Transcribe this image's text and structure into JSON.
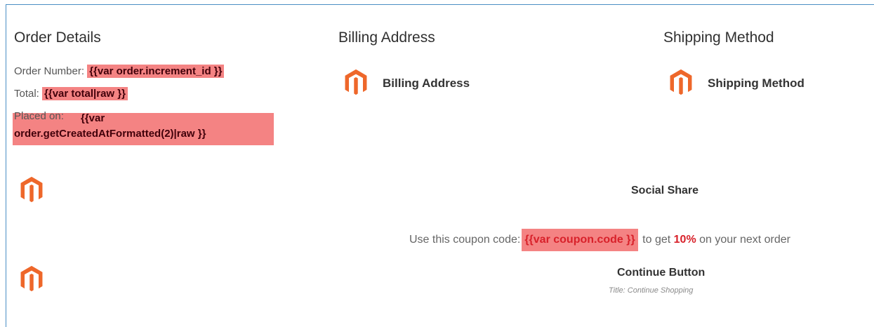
{
  "order_details": {
    "title": "Order Details",
    "order_number_label": "Order Number:",
    "order_number_var": "{{var order.increment_id }}",
    "total_label": "Total:",
    "total_var": "{{var total|raw }}",
    "placed_on_label": "Placed on:",
    "placed_on_var_line1": "{{var",
    "placed_on_var_line2": "order.getCreatedAtFormatted(2)|raw }}"
  },
  "billing": {
    "title": "Billing Address",
    "block_label": "Billing Address"
  },
  "shipping": {
    "title": "Shipping Method",
    "block_label": "Shipping Method"
  },
  "social_share": {
    "label": "Social Share"
  },
  "coupon": {
    "prefix": "Use this coupon code:",
    "code_var": "{{var coupon.code }}",
    "middle": "to get",
    "percent": "10%",
    "suffix": "on your next order"
  },
  "continue_button": {
    "label": "Continue Button",
    "subtitle": "Title: Continue Shopping"
  },
  "icons": {
    "brand_logo": "magento-logo-icon",
    "brand_color": "#ee672a"
  }
}
